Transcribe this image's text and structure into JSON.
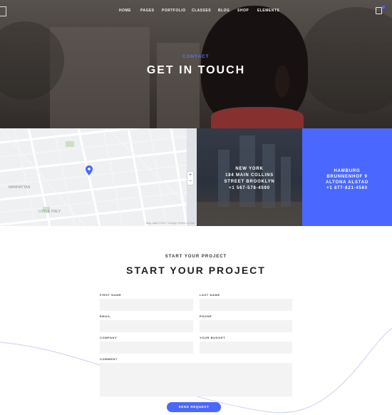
{
  "nav": {
    "items": [
      "HOME",
      "PAGES",
      "PORTFOLIO",
      "CLASSES",
      "BLOG",
      "SHOP",
      "ELEMENTS"
    ]
  },
  "hero": {
    "eyebrow": "CONTACT",
    "title": "GET IN TOUCH"
  },
  "map": {
    "labels": [
      "MANHATTAN",
      "LITTLE ITALY"
    ],
    "credit": "Map data ©2017 Google  Terms of Use"
  },
  "offices": [
    {
      "lines": [
        "NEW YORK",
        "184 MAIN COLLINS",
        "STREET BROOKLYN",
        "+1 567-578-4590"
      ]
    },
    {
      "lines": [
        "HAMBURG",
        "BRUNNENHOF 9",
        "ALTONA ALSTAD",
        "+1 877-821-4560"
      ]
    }
  ],
  "form": {
    "eyebrow": "START YOUR PROJECT",
    "title": "START YOUR PROJECT",
    "fields": {
      "first_name": "FIRST NAME",
      "last_name": "LAST NAME",
      "email": "EMAIL",
      "phone": "PHONE",
      "company": "COMPANY",
      "budget": "YOUR BUDGET",
      "comment": "COMMENT"
    },
    "submit": "SEND REQUEST"
  },
  "colors": {
    "accent": "#4a68ff",
    "hero_overlay": "#3b3532",
    "input_bg": "#f3f3f4"
  },
  "icons": [
    "menu-icon",
    "shopping-bag-icon",
    "map-pin-icon",
    "zoom-in-icon",
    "zoom-out-icon"
  ]
}
